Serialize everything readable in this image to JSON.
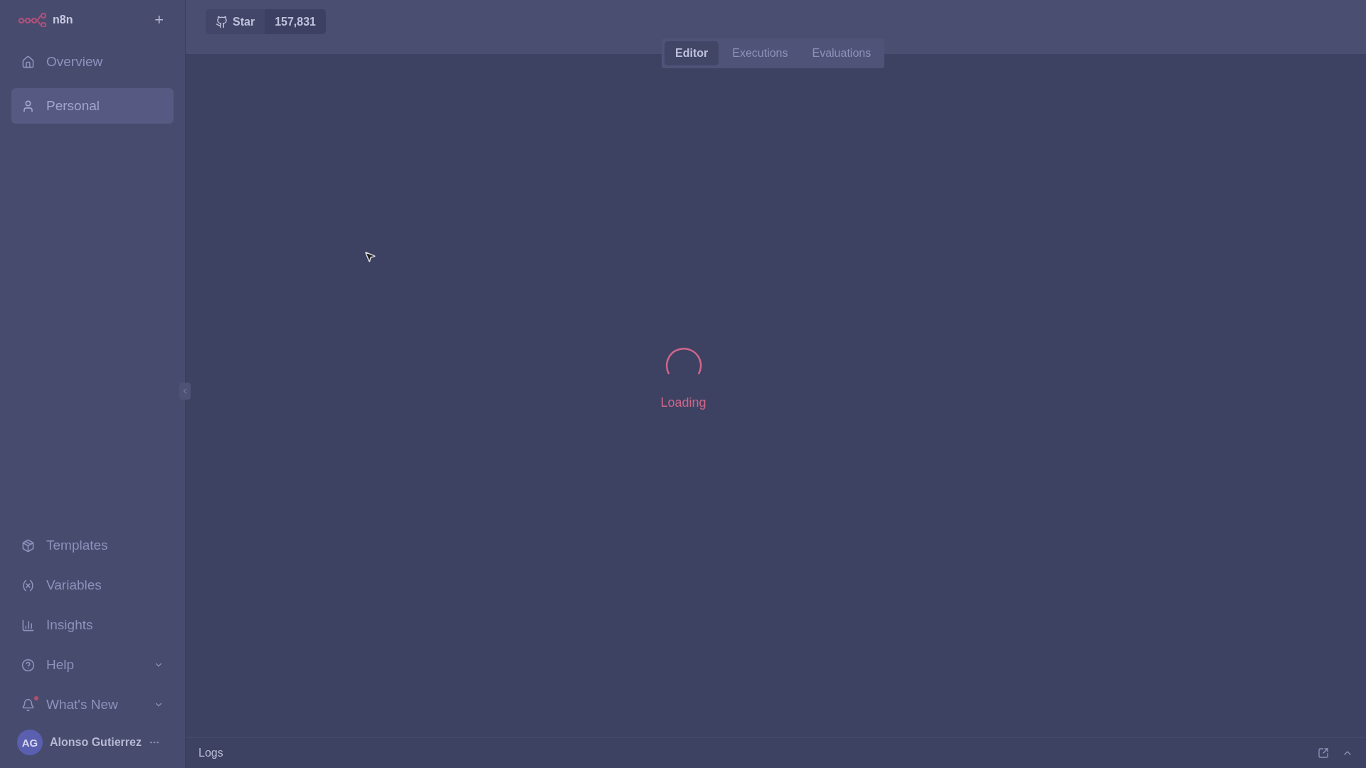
{
  "sidebar": {
    "brand": "n8n",
    "add_button": "+",
    "top_items": [
      {
        "label": "Overview",
        "selected": false
      },
      {
        "label": "Personal",
        "selected": true
      }
    ],
    "bottom_items": [
      {
        "label": "Templates",
        "expandable": false,
        "notification": false
      },
      {
        "label": "Variables",
        "expandable": false,
        "notification": false
      },
      {
        "label": "Insights",
        "expandable": false,
        "notification": false
      },
      {
        "label": "Help",
        "expandable": true,
        "notification": false
      },
      {
        "label": "What's New",
        "expandable": true,
        "notification": true
      }
    ],
    "user": {
      "initials": "AG",
      "name": "Alonso Gutierrez"
    }
  },
  "header": {
    "github": {
      "label": "Star",
      "count": "157,831"
    },
    "tabs": [
      {
        "label": "Editor",
        "selected": true
      },
      {
        "label": "Executions",
        "selected": false
      },
      {
        "label": "Evaluations",
        "selected": false
      }
    ]
  },
  "canvas": {
    "status": "Loading"
  },
  "logs": {
    "title": "Logs"
  }
}
